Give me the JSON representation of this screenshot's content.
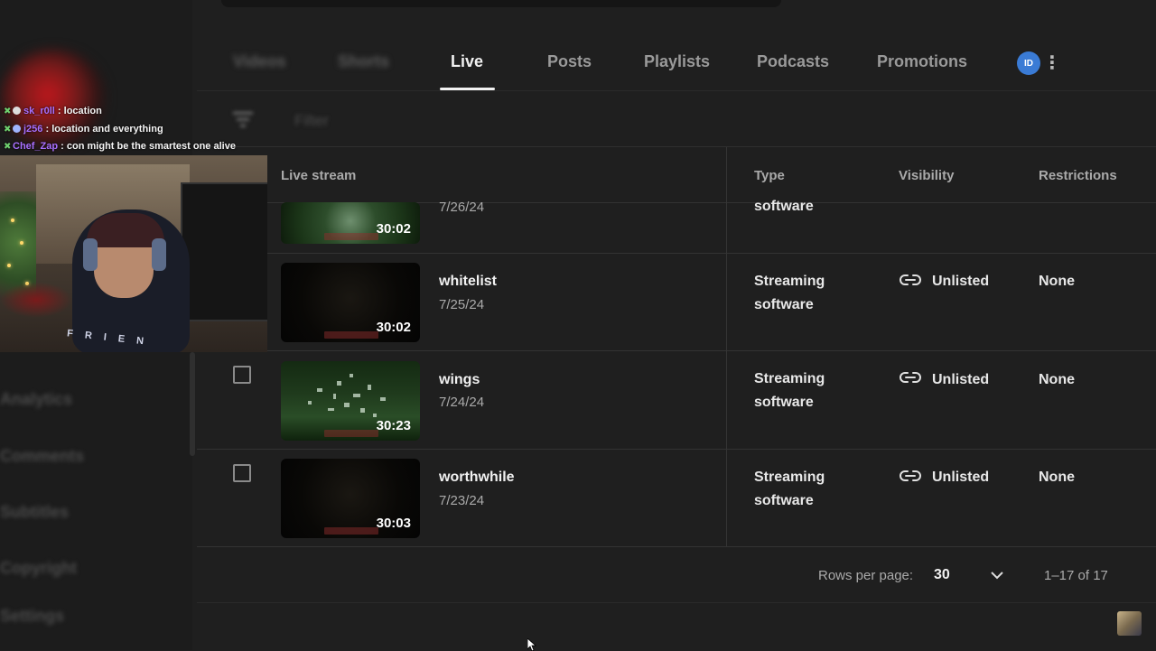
{
  "tabs": [
    {
      "label": "Videos"
    },
    {
      "label": "Shorts"
    },
    {
      "label": "Live"
    },
    {
      "label": "Posts"
    },
    {
      "label": "Playlists"
    },
    {
      "label": "Podcasts"
    },
    {
      "label": "Promotions"
    }
  ],
  "active_tab": "Live",
  "filter": {
    "placeholder": "Filter"
  },
  "table": {
    "headers": {
      "stream": "Live stream",
      "type": "Type",
      "visibility": "Visibility",
      "restrictions": "Restrictions"
    },
    "rows": [
      {
        "title": "",
        "date": "7/26/24",
        "duration": "30:02",
        "type_line1": "",
        "type_line2": "software",
        "visibility": "",
        "restrictions": ""
      },
      {
        "title": "whitelist",
        "date": "7/25/24",
        "duration": "30:02",
        "type_line1": "Streaming",
        "type_line2": "software",
        "visibility": "Unlisted",
        "restrictions": "None"
      },
      {
        "title": "wings",
        "date": "7/24/24",
        "duration": "30:23",
        "type_line1": "Streaming",
        "type_line2": "software",
        "visibility": "Unlisted",
        "restrictions": "None"
      },
      {
        "title": "worthwhile",
        "date": "7/23/24",
        "duration": "30:03",
        "type_line1": "Streaming",
        "type_line2": "software",
        "visibility": "Unlisted",
        "restrictions": "None"
      }
    ]
  },
  "pagination": {
    "rows_label": "Rows per page:",
    "rows_value": "30",
    "range": "1–17 of 17"
  },
  "sidebar": {
    "items": [
      "Analytics",
      "Comments",
      "Subtitles",
      "Copyright",
      "Settings"
    ]
  },
  "studio_icon_text": "ID",
  "stream_overlay": {
    "chat": [
      {
        "user": "sk_r0ll",
        "message": " : location"
      },
      {
        "user": "j256",
        "message": " : location and everything"
      },
      {
        "user": "Chef_Zap",
        "message": " : con might be the smartest one alive"
      }
    ],
    "shirt_text": "F R I E N"
  },
  "colors": {
    "background": "#1f1f1f",
    "text": "#f1f1f1",
    "muted": "#aaaaaa",
    "chat_user": "#a970ff"
  }
}
